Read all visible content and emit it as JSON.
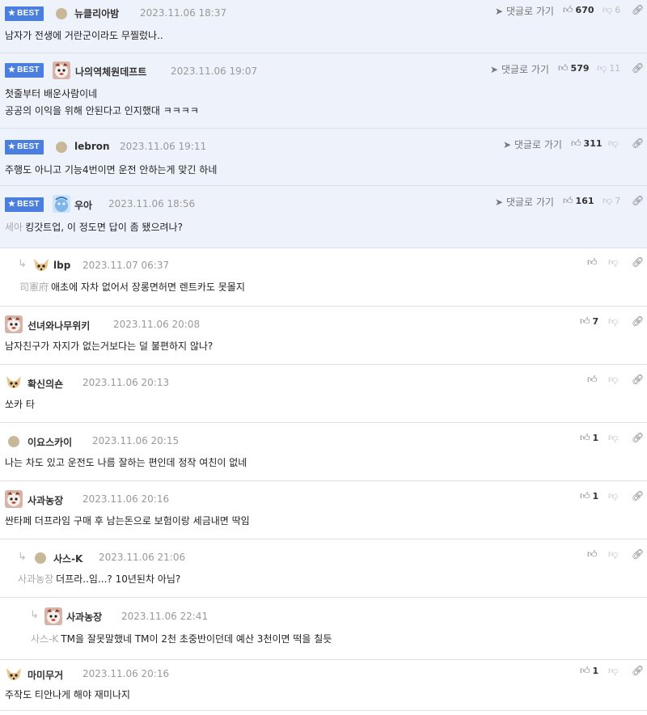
{
  "labels": {
    "best": "BEST",
    "goto_reply": "댓글로 가기"
  },
  "comments": [
    {
      "best": true,
      "nick": "뉴클리아밤",
      "date": "2023.11.06 18:37",
      "up": "670",
      "down": "6",
      "lines": [
        "남자가 전생에 거란군이라도 무찔렀나.."
      ]
    },
    {
      "best": true,
      "nick": "나의역체원데프트",
      "date": "2023.11.06 19:07",
      "up": "579",
      "down": "11",
      "lines": [
        "첫줄부터 배운사람이네",
        "공공의 이익을 위해 안된다고 인지했대 ㅋㅋㅋㅋ"
      ]
    },
    {
      "best": true,
      "nick": "lebron",
      "date": "2023.11.06 19:11",
      "up": "311",
      "down": "",
      "lines": [
        "주행도 아니고 기능4번이면 운전 안하는게 맞긴 하네"
      ]
    },
    {
      "best": true,
      "nick": "우아",
      "date": "2023.11.06 18:56",
      "up": "161",
      "down": "7",
      "target": "세아",
      "lines": [
        "킹갓트업, 이 정도면 답이 좀 됐으려나?"
      ]
    },
    {
      "nick": "lbp",
      "date": "2023.11.07 06:37",
      "up": "",
      "down": "",
      "target": "司憲府",
      "lines": [
        "애초에 자차 없어서 장롱면허면 렌트카도 못몰지"
      ]
    },
    {
      "nick": "선녀와나무위키",
      "date": "2023.11.06 20:08",
      "up": "7",
      "down": "",
      "lines": [
        "남자친구가 자지가 없는거보다는 덜 불편하지 않나?"
      ]
    },
    {
      "nick": "확신의숀",
      "date": "2023.11.06 20:13",
      "up": "",
      "down": "",
      "lines": [
        "쏘카 타"
      ]
    },
    {
      "nick": "이요스카이",
      "date": "2023.11.06 20:15",
      "up": "1",
      "down": "",
      "lines": [
        "나는 차도 있고 운전도 나름 잘하는 편인데 정작 여친이 없네"
      ]
    },
    {
      "nick": "사과농장",
      "date": "2023.11.06 20:16",
      "up": "1",
      "down": "",
      "lines": [
        "싼타페 더프라임 구매 후 남는돈으로 보험이랑 세금내면 딱임"
      ]
    },
    {
      "nick": "사스-K",
      "date": "2023.11.06 21:06",
      "up": "",
      "down": "",
      "target": "사과농장",
      "lines": [
        "더프라..임...? 10년된차 아님?"
      ]
    },
    {
      "nick": "사과농장",
      "date": "2023.11.06 22:41",
      "up": "",
      "down": "",
      "target": "사스-K",
      "lines": [
        "TM을 잘못말했네 TM이 2천 초중반이던데 예산 3천이면 떡을 칠듯"
      ]
    },
    {
      "nick": "마미무거",
      "date": "2023.11.06 20:16",
      "up": "1",
      "down": "",
      "lines": [
        "주작도 티안나게 해야 재미나지"
      ]
    }
  ]
}
